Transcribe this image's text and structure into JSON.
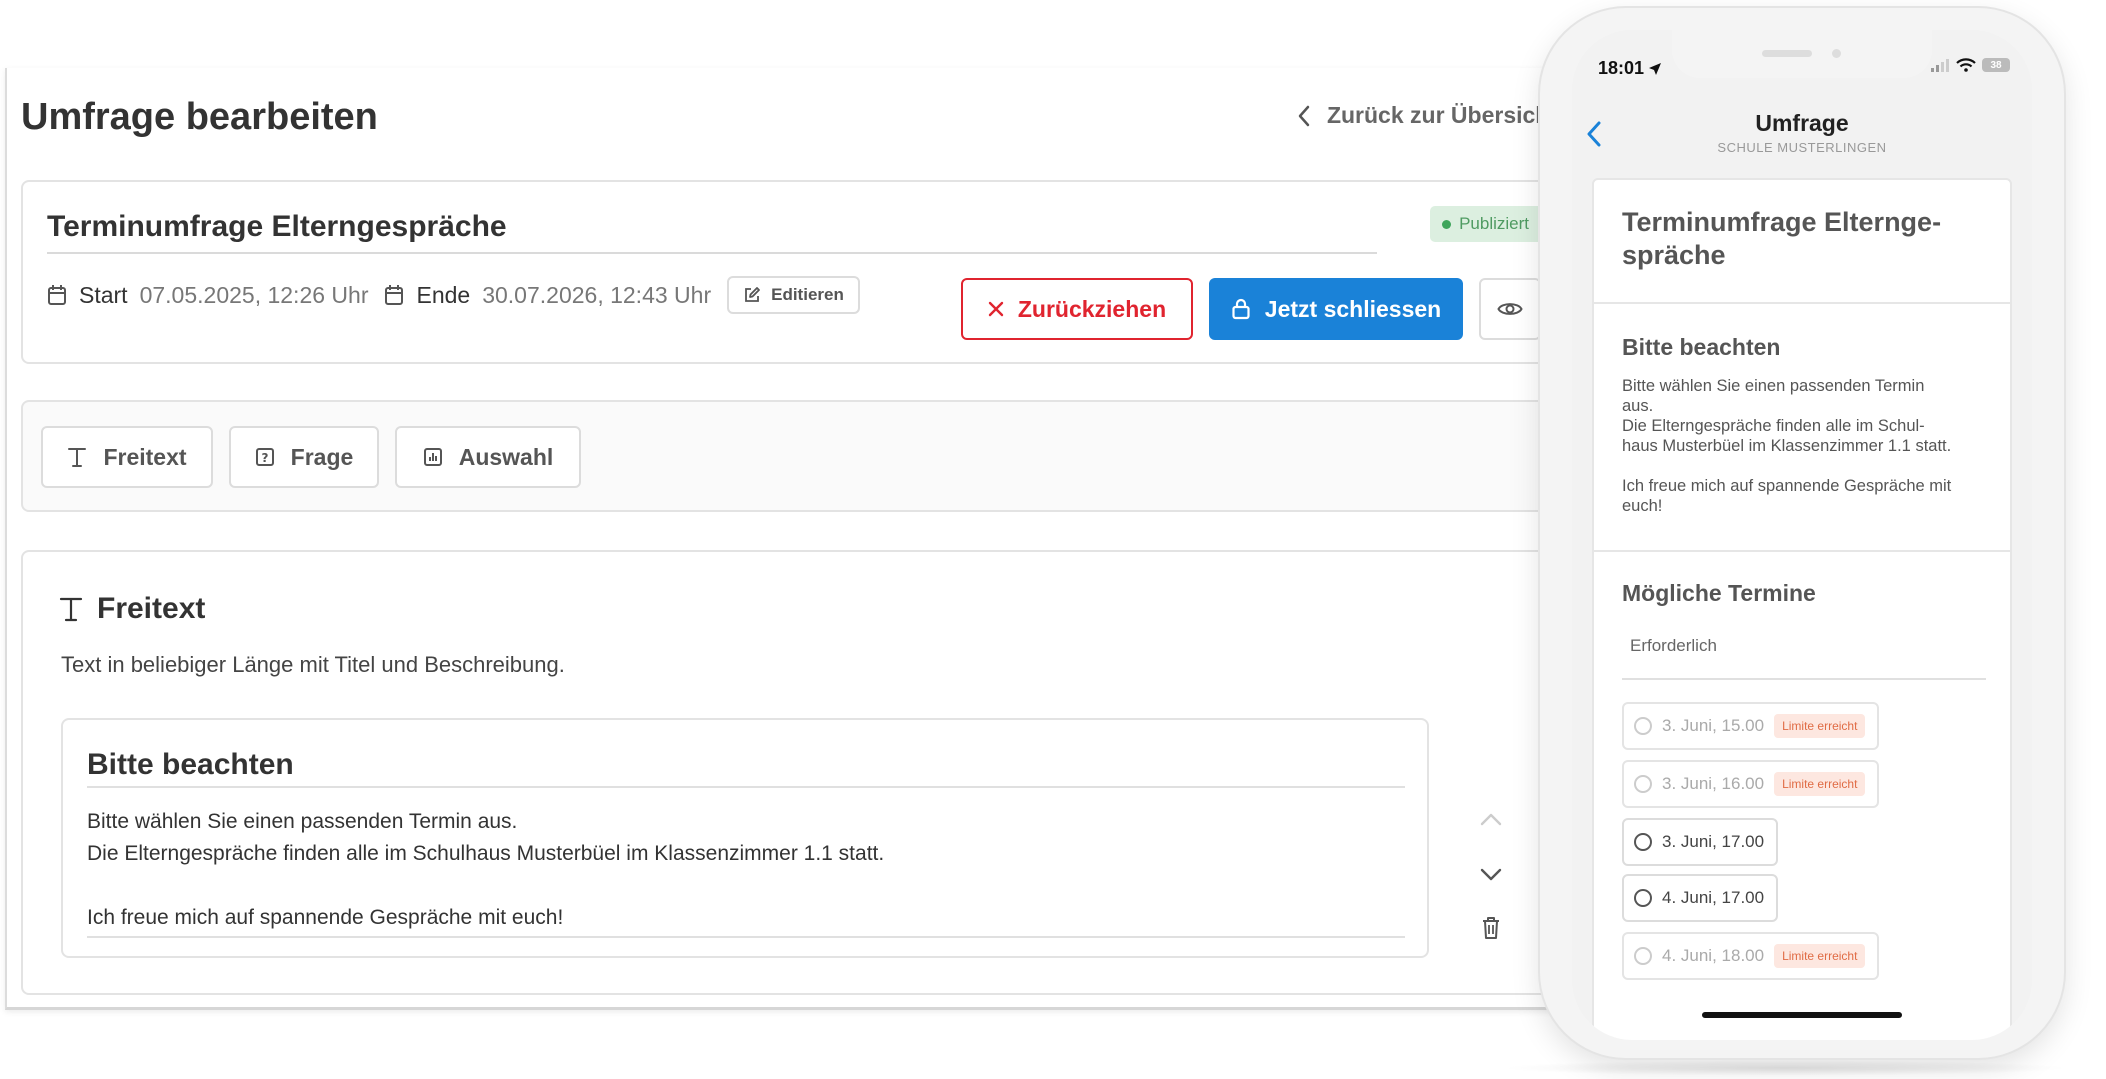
{
  "editor": {
    "page_title": "Umfrage bearbeiten",
    "back_link": "Zurück zur Übersicht",
    "survey": {
      "title": "Terminumfrage Elterngespräche",
      "status": "Publiziert",
      "start_label": "Start",
      "start_value": "07.05.2025, 12:26 Uhr",
      "end_label": "Ende",
      "end_value": "30.07.2026, 12:43 Uhr",
      "edit_label": "Editieren",
      "withdraw_label": "Zurückziehen",
      "close_label": "Jetzt schliessen"
    },
    "toolbar": {
      "freetext_label": "Freitext",
      "question_label": "Frage",
      "choice_label": "Auswahl"
    },
    "block": {
      "type_label": "Freitext",
      "type_description": "Text in beliebiger Länge mit Titel und Beschreibung.",
      "content_title": "Bitte beachten",
      "content_lines": [
        "Bitte wählen Sie einen passenden Termin aus.",
        "Die Elterngespräche finden alle im Schulhaus Musterbüel im Klassenzimmer 1.1 statt.",
        "",
        "Ich freue mich auf spannende Gespräche mit euch!"
      ]
    }
  },
  "phone": {
    "time": "18:01",
    "battery": "38",
    "nav_title": "Umfrage",
    "nav_subtitle": "SCHULE MUSTERLINGEN",
    "survey_title_lines": [
      "Terminumfrage Elternge-",
      "spräche"
    ],
    "note_title": "Bitte beachten",
    "note_lines": [
      "Bitte wählen Sie einen passenden Termin",
      "aus.",
      "Die Elterngespräche finden alle im Schul-",
      "haus Musterbüel im Klassenzimmer 1.1 statt.",
      "",
      "Ich freue mich auf spannende Gespräche mit",
      "euch!"
    ],
    "dates_title": "Mögliche Termine",
    "required_label": "Erforderlich",
    "options": [
      {
        "label": "3. Juni, 15.00",
        "badge": "Limite erreicht"
      },
      {
        "label": "3. Juni, 16.00",
        "badge": "Limite erreicht"
      },
      {
        "label": "3. Juni, 17.00",
        "badge": ""
      },
      {
        "label": "4. Juni, 17.00",
        "badge": ""
      },
      {
        "label": "4. Juni, 18.00",
        "badge": "Limite erreicht"
      }
    ]
  },
  "colors": {
    "primary": "#1a82d8",
    "danger": "#e0242f",
    "success": "#3fa55b",
    "limit": "#e06b44"
  }
}
